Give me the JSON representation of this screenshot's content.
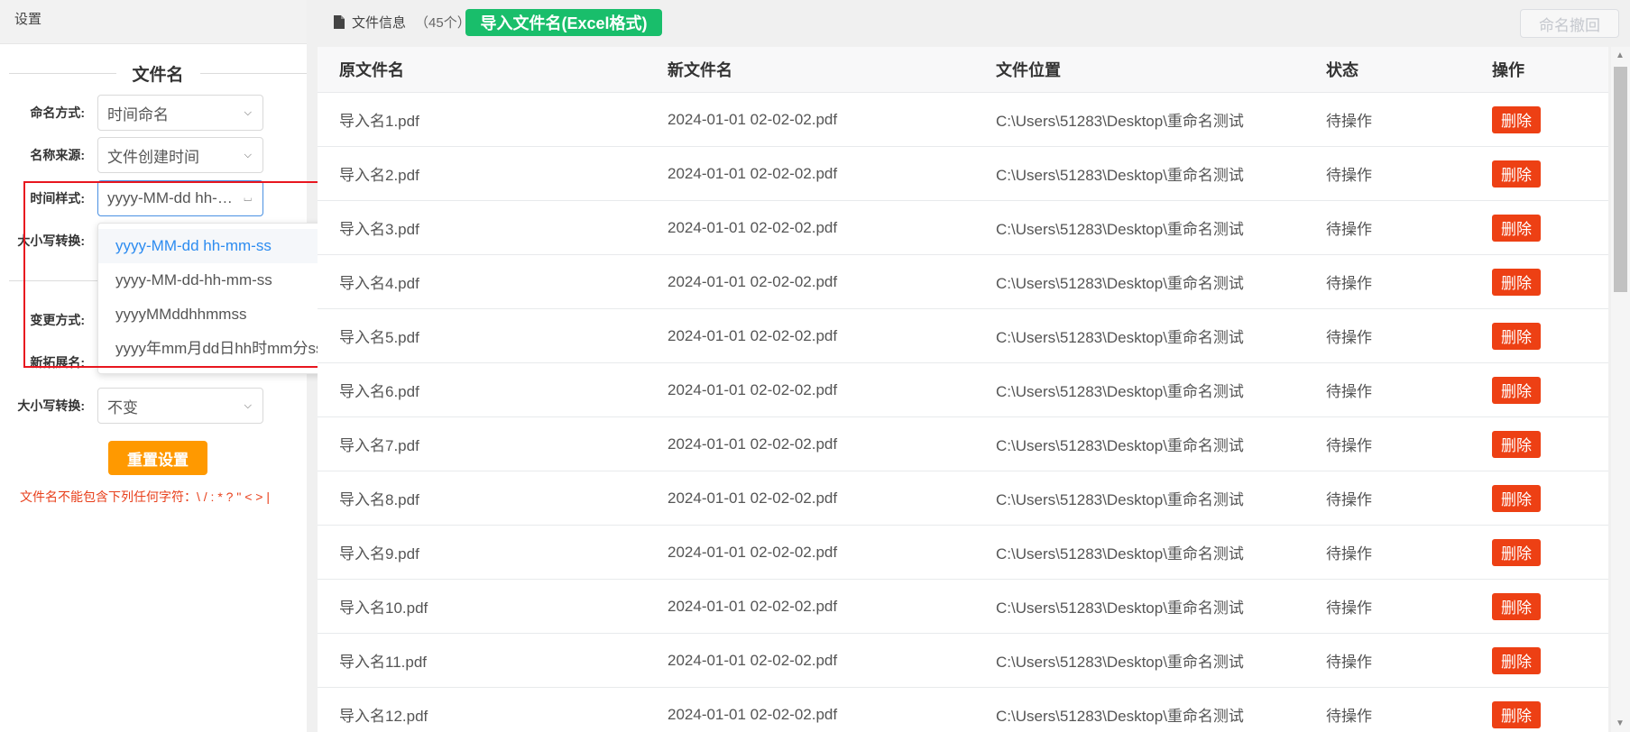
{
  "left_panel": {
    "title": "设置",
    "section_title": "文件名",
    "fields": [
      {
        "label": "命名方式:",
        "value": "时间命名"
      },
      {
        "label": "名称来源:",
        "value": "文件创建时间"
      },
      {
        "label": "时间样式:",
        "value": "yyyy-MM-dd hh-mm-ss"
      },
      {
        "label": "大小写转换:",
        "value": ""
      },
      {
        "label": "变更方式:",
        "value": ""
      },
      {
        "label": "新拓展名:",
        "value": ""
      },
      {
        "label": "大小写转换:",
        "value": "不变"
      }
    ],
    "dropdown_options": [
      {
        "label": "yyyy-MM-dd hh-mm-ss",
        "selected": true
      },
      {
        "label": "yyyy-MM-dd-hh-mm-ss",
        "selected": false
      },
      {
        "label": "yyyyMMddhhmmss",
        "selected": false
      },
      {
        "label": "yyyy年mm月dd日hh时mm分ss秒",
        "selected": false
      }
    ],
    "reset_button": "重置设置",
    "warning": "文件名不能包含下列任何字符：\\ / : * ? \" < > |"
  },
  "toolbar": {
    "file_info_label": "文件信息",
    "file_count": "（45个）",
    "import_button": "导入文件名(Excel格式)",
    "undo_button": "命名撤回"
  },
  "table": {
    "headers": [
      "原文件名",
      "新文件名",
      "文件位置",
      "状态",
      "操作"
    ],
    "rows": [
      {
        "orig": "导入名1.pdf",
        "new": "2024-01-01 02-02-02.pdf",
        "loc": "C:\\Users\\51283\\Desktop\\重命名测试",
        "status": "待操作",
        "action": "删除"
      },
      {
        "orig": "导入名2.pdf",
        "new": "2024-01-01 02-02-02.pdf",
        "loc": "C:\\Users\\51283\\Desktop\\重命名测试",
        "status": "待操作",
        "action": "删除"
      },
      {
        "orig": "导入名3.pdf",
        "new": "2024-01-01 02-02-02.pdf",
        "loc": "C:\\Users\\51283\\Desktop\\重命名测试",
        "status": "待操作",
        "action": "删除"
      },
      {
        "orig": "导入名4.pdf",
        "new": "2024-01-01 02-02-02.pdf",
        "loc": "C:\\Users\\51283\\Desktop\\重命名测试",
        "status": "待操作",
        "action": "删除"
      },
      {
        "orig": "导入名5.pdf",
        "new": "2024-01-01 02-02-02.pdf",
        "loc": "C:\\Users\\51283\\Desktop\\重命名测试",
        "status": "待操作",
        "action": "删除"
      },
      {
        "orig": "导入名6.pdf",
        "new": "2024-01-01 02-02-02.pdf",
        "loc": "C:\\Users\\51283\\Desktop\\重命名测试",
        "status": "待操作",
        "action": "删除"
      },
      {
        "orig": "导入名7.pdf",
        "new": "2024-01-01 02-02-02.pdf",
        "loc": "C:\\Users\\51283\\Desktop\\重命名测试",
        "status": "待操作",
        "action": "删除"
      },
      {
        "orig": "导入名8.pdf",
        "new": "2024-01-01 02-02-02.pdf",
        "loc": "C:\\Users\\51283\\Desktop\\重命名测试",
        "status": "待操作",
        "action": "删除"
      },
      {
        "orig": "导入名9.pdf",
        "new": "2024-01-01 02-02-02.pdf",
        "loc": "C:\\Users\\51283\\Desktop\\重命名测试",
        "status": "待操作",
        "action": "删除"
      },
      {
        "orig": "导入名10.pdf",
        "new": "2024-01-01 02-02-02.pdf",
        "loc": "C:\\Users\\51283\\Desktop\\重命名测试",
        "status": "待操作",
        "action": "删除"
      },
      {
        "orig": "导入名11.pdf",
        "new": "2024-01-01 02-02-02.pdf",
        "loc": "C:\\Users\\51283\\Desktop\\重命名测试",
        "status": "待操作",
        "action": "删除"
      },
      {
        "orig": "导入名12.pdf",
        "new": "2024-01-01 02-02-02.pdf",
        "loc": "C:\\Users\\51283\\Desktop\\重命名测试",
        "status": "待操作",
        "action": "删除"
      }
    ]
  },
  "colors": {
    "import_green": "#19be6b",
    "reset_orange": "#ff9900",
    "delete_red": "#ed4014",
    "highlight_red": "#e8161f",
    "active_blue": "#2d8cf0"
  }
}
